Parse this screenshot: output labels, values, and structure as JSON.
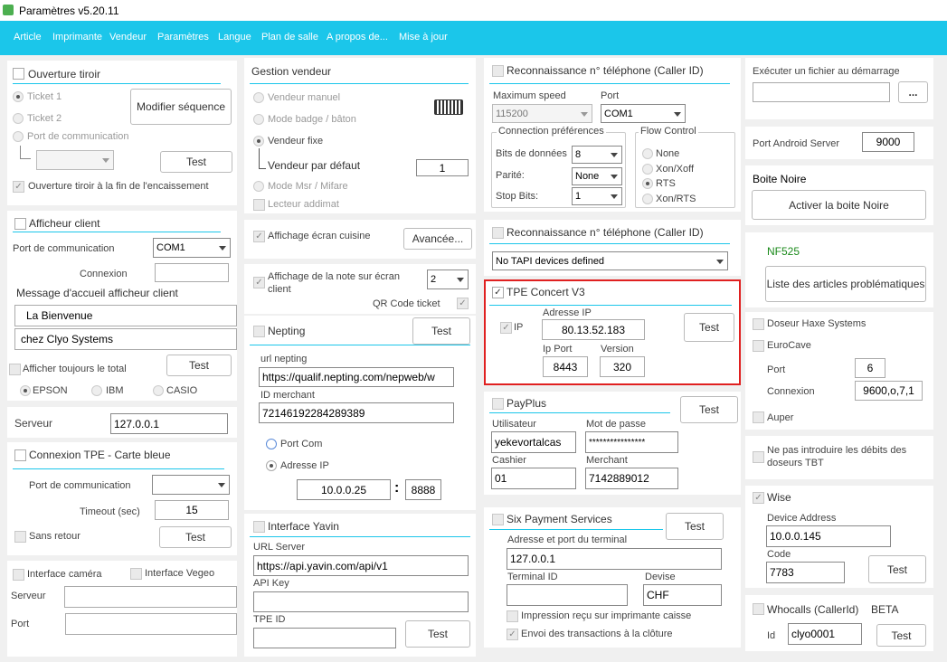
{
  "window": {
    "title": "Paramètres v5.20.11"
  },
  "menu": [
    "Article",
    "Imprimante",
    "Vendeur",
    "Paramètres",
    "Langue",
    "Plan de salle",
    "A propos de...",
    "Mise à jour"
  ],
  "tiroir": {
    "title": "Ouverture tiroir",
    "ticket1": "Ticket 1",
    "ticket2": "Ticket 2",
    "port_label": "Port de communication",
    "modifier": "Modifier séquence",
    "test": "Test",
    "fin": "Ouverture tiroir à la fin de l'encaissement"
  },
  "afficheur": {
    "title": "Afficheur client",
    "port_label": "Port de communication",
    "port": "COM1",
    "connexion": "Connexion",
    "message_label": "Message d'accueil afficheur client",
    "line1": "La Bienvenue",
    "line2": "chez Clyo Systems",
    "toujours": "Afficher toujours le total",
    "test": "Test",
    "epson": "EPSON",
    "ibm": "IBM",
    "casio": "CASIO"
  },
  "serveur": {
    "label": "Serveur",
    "value": "127.0.0.1"
  },
  "tpe": {
    "title": "Connexion TPE - Carte bleue",
    "port_label": "Port de communication",
    "timeout_label": "Timeout (sec)",
    "timeout": "15",
    "sans_retour": "Sans retour",
    "test": "Test"
  },
  "camera": {
    "interface": "Interface caméra",
    "vegeo": "Interface Vegeo",
    "serveur": "Serveur",
    "port": "Port"
  },
  "vendeur": {
    "title": "Gestion vendeur",
    "manuel": "Vendeur manuel",
    "badge": "Mode badge / bâton",
    "fixe": "Vendeur fixe",
    "defaut_label": "Vendeur par défaut",
    "defaut": "1",
    "msr": "Mode Msr / Mifare",
    "addimat": "Lecteur addimat",
    "keyboard_icon": "keyboard-icon"
  },
  "cuisine": {
    "label": "Affichage écran cuisine",
    "avancee": "Avancée..."
  },
  "note": {
    "label": "Affichage de la note sur écran client",
    "value": "2",
    "qr": "QR Code ticket"
  },
  "nepting": {
    "title": "Nepting",
    "test": "Test",
    "url_label": "url nepting",
    "url": "https://qualif.nepting.com/nepweb/w",
    "id_label": "ID merchant",
    "id": "72146192284289389",
    "portcom": "Port Com",
    "ip": "Adresse IP",
    "ip_value": "10.0.0.25",
    "sep": ":",
    "port": "8888"
  },
  "yavin": {
    "title": "Interface Yavin",
    "url_label": "URL Server",
    "url": "https://api.yavin.com/api/v1",
    "key_label": "API Key",
    "tpe_label": "TPE ID",
    "test": "Test"
  },
  "callerid1": {
    "title": "Reconnaissance n° téléphone (Caller ID)",
    "speed_label": "Maximum speed",
    "speed": "115200",
    "port_label": "Port",
    "port": "COM1",
    "conn_label": "Connection préférences",
    "bits_label": "Bits de données",
    "bits": "8",
    "parite_label": "Parité:",
    "parite": "None",
    "stop_label": "Stop Bits:",
    "stop": "1",
    "flow_label": "Flow Control",
    "flow_none": "None",
    "flow_xon": "Xon/Xoff",
    "flow_rts": "RTS",
    "flow_xonrts": "Xon/RTS"
  },
  "callerid2": {
    "title": "Reconnaissance n° téléphone (Caller ID)",
    "device": "No TAPI devices defined"
  },
  "concert": {
    "title": "TPE Concert V3",
    "ip_cb": "IP",
    "ip_label": "Adresse IP",
    "ip": "80.13.52.183",
    "port_label": "Ip Port",
    "port": "8443",
    "version_label": "Version",
    "version": "320",
    "test": "Test"
  },
  "payplus": {
    "title": "PayPlus",
    "test": "Test",
    "user_label": "Utilisateur",
    "user": "yekevortalcas",
    "pwd_label": "Mot de passe",
    "pwd": "****************",
    "cashier_label": "Cashier",
    "cashier": "01",
    "merchant_label": "Merchant",
    "merchant": "7142889012"
  },
  "six": {
    "title": "Six Payment Services",
    "test": "Test",
    "addr_label": "Adresse et port du terminal",
    "addr": "127.0.0.1",
    "terminal_label": "Terminal ID",
    "devise_label": "Devise",
    "devise": "CHF",
    "impression": "Impression reçu sur imprimante caisse",
    "envoi": "Envoi des transactions à la clôture"
  },
  "demarrage": {
    "label": "Exécuter un fichier au démarrage",
    "browse": "..."
  },
  "android": {
    "label": "Port Android Server",
    "value": "9000"
  },
  "boite": {
    "title": "Boite Noire",
    "activer": "Activer la boite Noire"
  },
  "nf525": {
    "title": "NF525",
    "liste": "Liste des articles problématiques",
    "color": "#1a8a1a"
  },
  "doseur": {
    "haxe": "Doseur Haxe Systems",
    "eurocave": "EuroCave",
    "port_label": "Port",
    "port": "6",
    "conn_label": "Connexion",
    "conn": "9600,o,7,1",
    "auper": "Auper"
  },
  "tbt": {
    "label": "Ne pas introduire les débits des doseurs TBT"
  },
  "wise": {
    "title": "Wise",
    "device_label": "Device Address",
    "device": "10.0.0.145",
    "code_label": "Code",
    "code": "7783",
    "test": "Test"
  },
  "whocalls": {
    "title": "Whocalls (CallerId)",
    "beta": "BETA",
    "id_label": "Id",
    "id": "clyo0001",
    "test": "Test"
  },
  "colors": {
    "accent": "#1bc6ea",
    "highlight": "#e02020"
  }
}
